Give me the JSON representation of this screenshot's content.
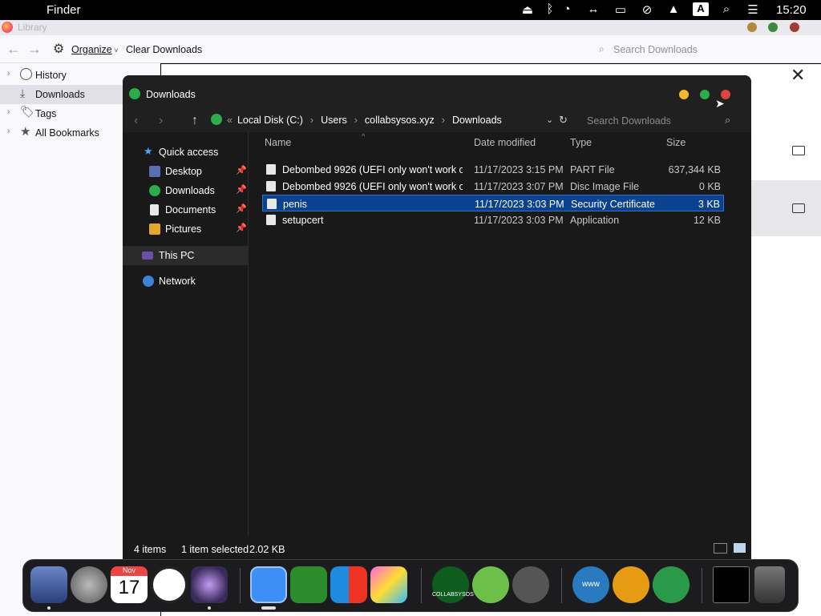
{
  "menubar": {
    "apple": "",
    "app_name": "Finder",
    "clock": "15:20"
  },
  "library": {
    "title": "Library",
    "toolbar": {
      "organize": "Organize",
      "clear_downloads": "Clear Downloads",
      "search_placeholder": "Search Downloads"
    },
    "sidebar": [
      {
        "label": "History",
        "icon": "clock-icon",
        "selected": false
      },
      {
        "label": "Downloads",
        "icon": "download-icon",
        "selected": true
      },
      {
        "label": "Tags",
        "icon": "tag-icon",
        "selected": false
      },
      {
        "label": "All Bookmarks",
        "icon": "star-icon",
        "selected": false
      }
    ],
    "close": "✕"
  },
  "explorer": {
    "title": "Downloads",
    "breadcrumb": [
      "Local Disk (C:)",
      "Users",
      "collabsysos.xyz",
      "Downloads"
    ],
    "breadcrumb_prefix": "«",
    "search_placeholder": "Search Downloads",
    "nav": {
      "quick_access": "Quick access",
      "items": [
        {
          "label": "Desktop",
          "pinned": true
        },
        {
          "label": "Downloads",
          "pinned": true
        },
        {
          "label": "Documents",
          "pinned": true
        },
        {
          "label": "Pictures",
          "pinned": true
        }
      ],
      "this_pc": "This PC",
      "network": "Network"
    },
    "columns": {
      "name": "Name",
      "date": "Date modified",
      "type": "Type",
      "size": "Size"
    },
    "files": [
      {
        "name": "Debombed 9926 (UEFI only won't work o...",
        "date": "11/17/2023 3:15 PM",
        "type": "PART File",
        "size": "637,344 KB",
        "selected": false
      },
      {
        "name": "Debombed 9926 (UEFI only won't work o...",
        "date": "11/17/2023 3:07 PM",
        "type": "Disc Image File",
        "size": "0 KB",
        "selected": false
      },
      {
        "name": "penis",
        "date": "11/17/2023 3:03 PM",
        "type": "Security Certificate",
        "size": "3 KB",
        "selected": true
      },
      {
        "name": "setupcert",
        "date": "11/17/2023 3:03 PM",
        "type": "Application",
        "size": "12 KB",
        "selected": false
      }
    ],
    "status": {
      "count": "4 items",
      "selected": "1 item selected",
      "size": "2.02 KB"
    }
  },
  "dock": {
    "calendar_month": "Nov",
    "calendar_day": "17",
    "collabsysos_label": "COLLABSYSOS",
    "www_label": "www"
  },
  "colors": {
    "accent_blue": "#0a4290",
    "dot_yellow": "#f5b82e",
    "dot_green": "#2dac4b",
    "dot_red": "#e0443e"
  }
}
